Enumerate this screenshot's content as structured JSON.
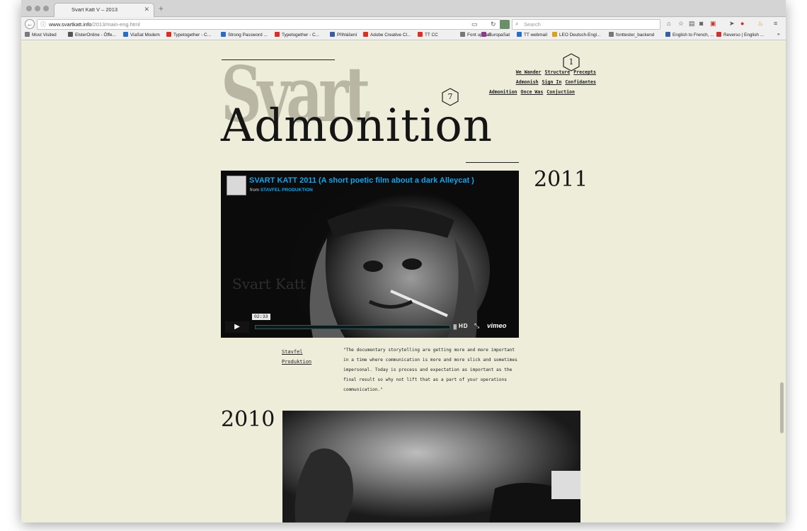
{
  "browser": {
    "tab_title": "Svart Katt V – 2013",
    "url_host": "www.svartkatt.info",
    "url_path": "/2013/main-eng.html",
    "search_placeholder": "Search",
    "bookmarks": [
      "Most Visited",
      "ElsterOnline - Öffe...",
      "ViaSat Modem",
      "Typetogether - C...",
      "Strong Password ...",
      "Typetogether - C...",
      "Přihlášení",
      "Adobe Creative Cl...",
      "TT CC",
      "Font upload",
      "EuropaSat",
      "TT webmail",
      "LEO Deutsch-Engl...",
      "fonttester_backend",
      "English to French, ...",
      "Reverso | English ..."
    ]
  },
  "site": {
    "heading": "Admonition",
    "watermark": "Svart",
    "nav_rows": [
      [
        "We Wander",
        "Structure",
        "Precepts"
      ],
      [
        "Admonish",
        "Sign In",
        "Confidantes"
      ],
      [
        "Admonition",
        "Once Was",
        "Conjuction"
      ]
    ],
    "badges": [
      "1",
      "7"
    ],
    "entries": [
      {
        "year": "2011",
        "video": {
          "title": "SVART KATT 2011 (A short poetic film about a dark Alleycat )",
          "from_label": "from",
          "from_name": "STAVFEL PRODUKTION",
          "time": "02:33",
          "hd": "HD",
          "brand": "vimeo",
          "watermark": "Svart Katt"
        },
        "credit_lines": [
          "Stavfel",
          "Produktion"
        ],
        "quote": "\"The documentary storytelling are getting more and more important in a time where communication is more and more slick and sometimes impersonal. Today is process and expectation as important as the final result so why not lift that as a part of your operations communication.\""
      },
      {
        "year": "2010"
      }
    ]
  },
  "colors": {
    "page_bg": "#ededda",
    "text": "#151515",
    "vimeo_blue": "#1aa3ea",
    "watermark": "#b4b29e"
  }
}
